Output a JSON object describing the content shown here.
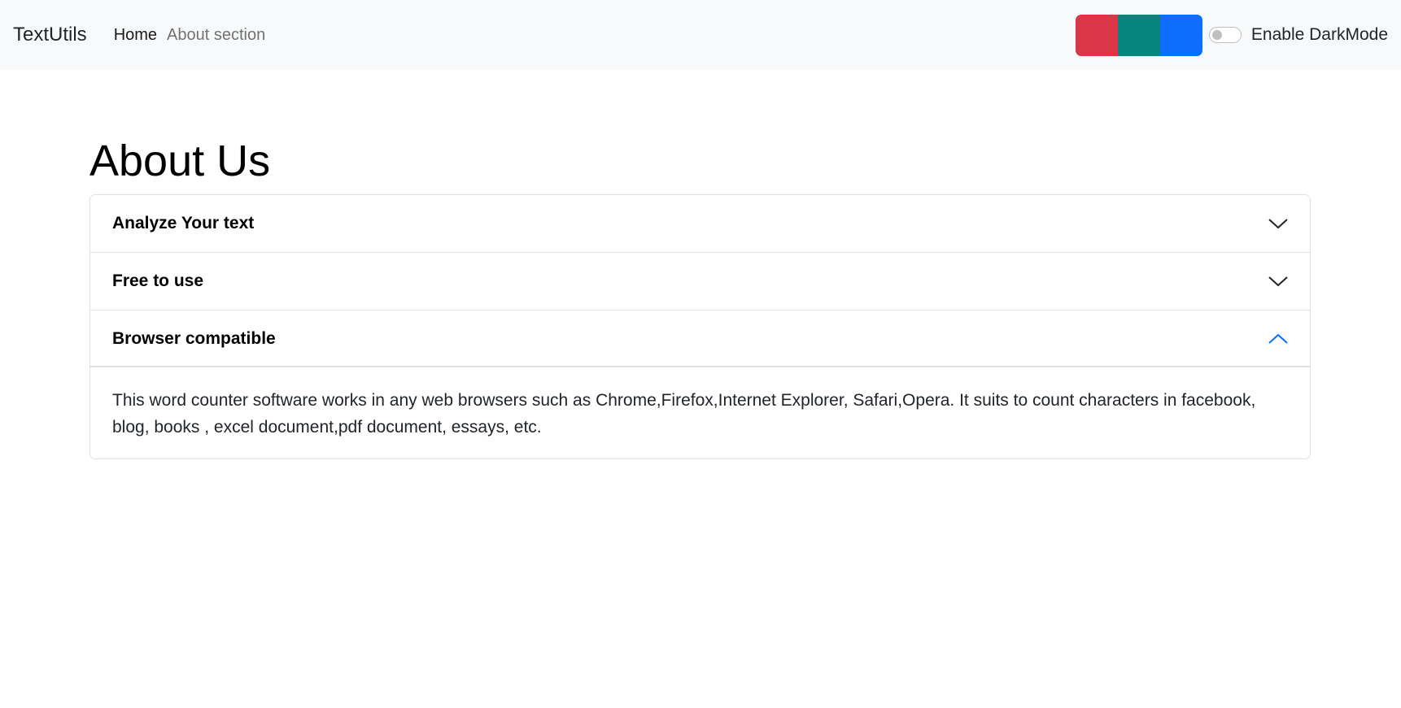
{
  "navbar": {
    "brand": "TextUtils",
    "links": [
      {
        "label": "Home",
        "active": true
      },
      {
        "label": "About section",
        "active": false
      }
    ],
    "color_swatches": [
      {
        "name": "red",
        "color": "#dc3545"
      },
      {
        "name": "teal",
        "color": "#06847e"
      },
      {
        "name": "blue",
        "color": "#0d6efd"
      }
    ],
    "darkmode_toggle": {
      "label": "Enable DarkMode",
      "checked": false
    }
  },
  "main": {
    "title": "About Us",
    "accordion": [
      {
        "title": "Analyze Your text",
        "expanded": false,
        "icon": "chevron-down-icon"
      },
      {
        "title": "Free to use",
        "expanded": false,
        "icon": "chevron-down-icon"
      },
      {
        "title": "Browser compatible",
        "expanded": true,
        "icon": "chevron-up-icon",
        "body": "This word counter software works in any web browsers such as Chrome,Firefox,Internet Explorer, Safari,Opera. It suits to count characters in facebook, blog, books , excel document,pdf document, essays, etc."
      }
    ]
  },
  "colors": {
    "navbar_bg": "#f8f9fa",
    "accent": "#0d6efd"
  }
}
